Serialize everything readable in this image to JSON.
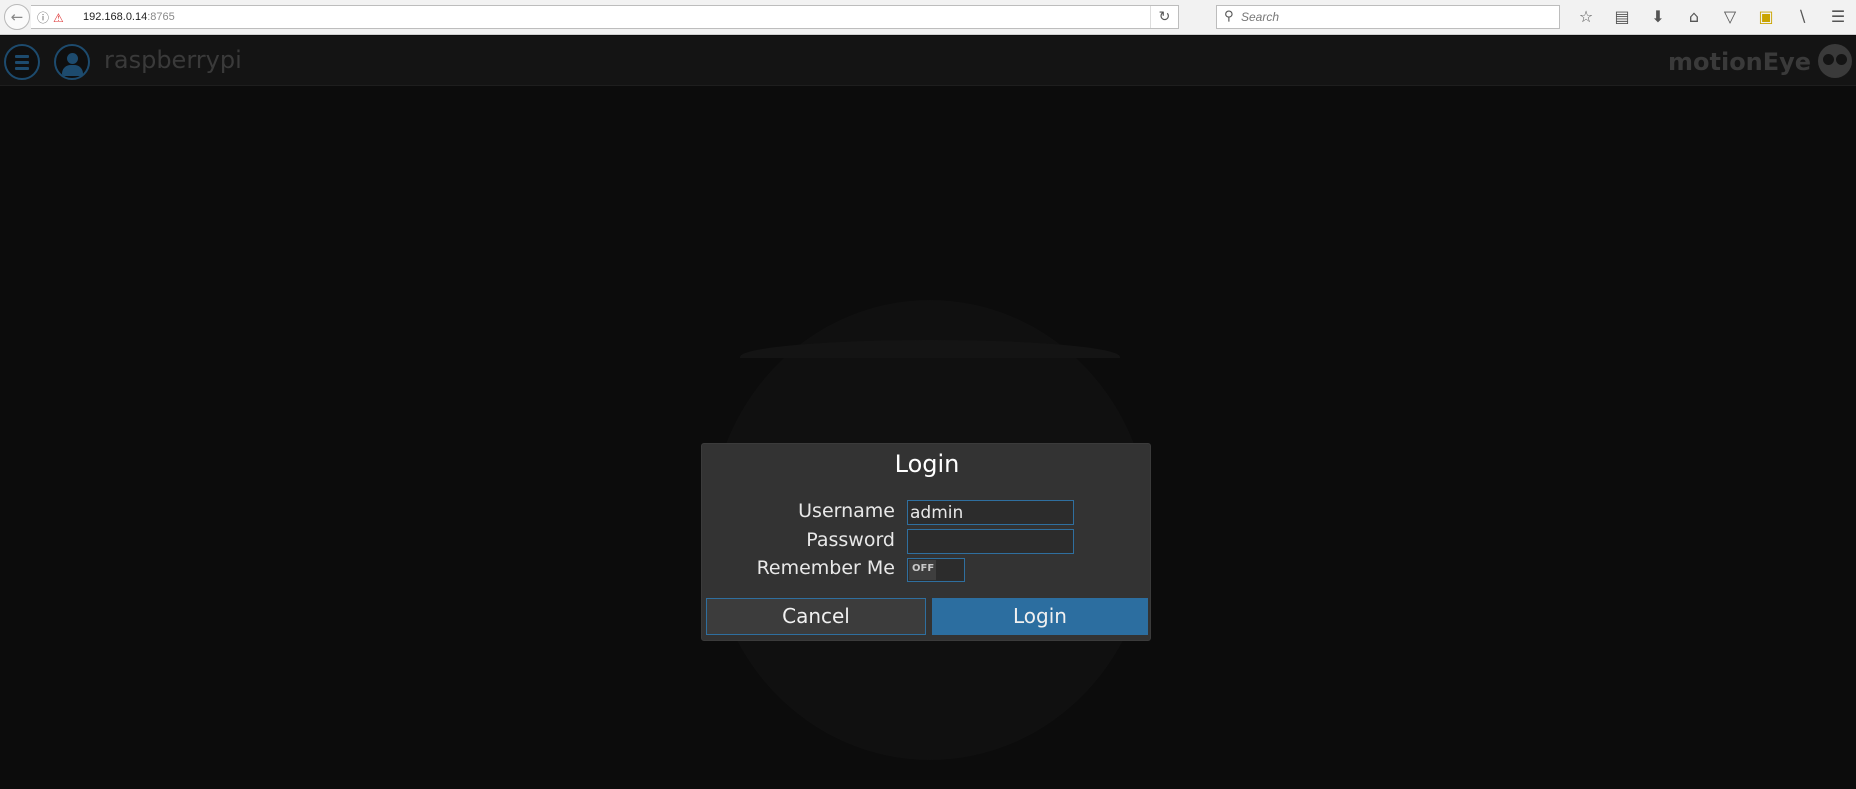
{
  "browser": {
    "url_host": "192.168.0.14",
    "url_port": ":8765",
    "search_placeholder": "Search"
  },
  "header": {
    "host_name": "raspberrypi",
    "brand": "motionEye"
  },
  "login_dialog": {
    "title": "Login",
    "username_label": "Username",
    "username_value": "admin",
    "password_label": "Password",
    "password_value": "",
    "remember_label": "Remember Me",
    "remember_state": "OFF",
    "cancel_label": "Cancel",
    "login_label": "Login"
  },
  "colors": {
    "accent": "#2c6ea0",
    "background": "#0c0c0c",
    "dialog": "#333333"
  }
}
